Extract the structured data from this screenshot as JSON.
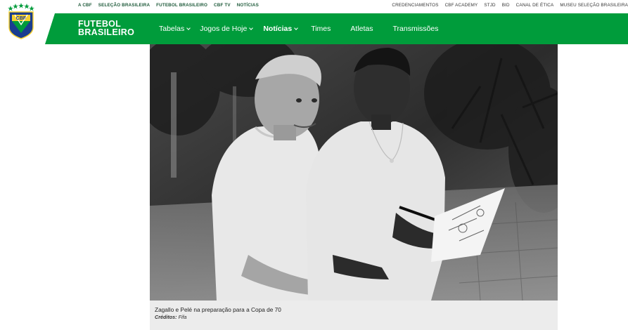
{
  "top_nav": {
    "left": [
      "A CBF",
      "SELEÇÃO BRASILEIRA",
      "FUTEBOL BRASILEIRO",
      "CBF TV",
      "NOTÍCIAS"
    ],
    "right": [
      "CREDENCIAMENTOS",
      "CBF ACADEMY",
      "STJD",
      "BID",
      "CANAL DE ÉTICA",
      "MUSEU SELEÇÃO BRASILEIRA"
    ]
  },
  "logo": {
    "text": "CBF",
    "icon": "cbf-crest-icon"
  },
  "brand": {
    "line1": "FUTEBOL",
    "line2": "BRASILEIRO"
  },
  "main_nav": [
    {
      "label": "Tabelas",
      "dropdown": true,
      "bold": false
    },
    {
      "label": "Jogos de Hoje",
      "dropdown": true,
      "bold": false
    },
    {
      "label": "Notícias",
      "dropdown": true,
      "bold": true
    },
    {
      "label": "Times",
      "dropdown": false,
      "bold": false
    },
    {
      "label": "Atletas",
      "dropdown": false,
      "bold": false
    },
    {
      "label": "Transmissões",
      "dropdown": false,
      "bold": false
    }
  ],
  "article_image": {
    "caption": "Zagallo e Pelé na preparação para a Copa de 70",
    "credit_label": "Créditos:",
    "credit_value": "Fifa"
  },
  "colors": {
    "brand_green": "#009c3b",
    "crest_blue": "#1a3d8f",
    "crest_yellow": "#f6d02f"
  }
}
